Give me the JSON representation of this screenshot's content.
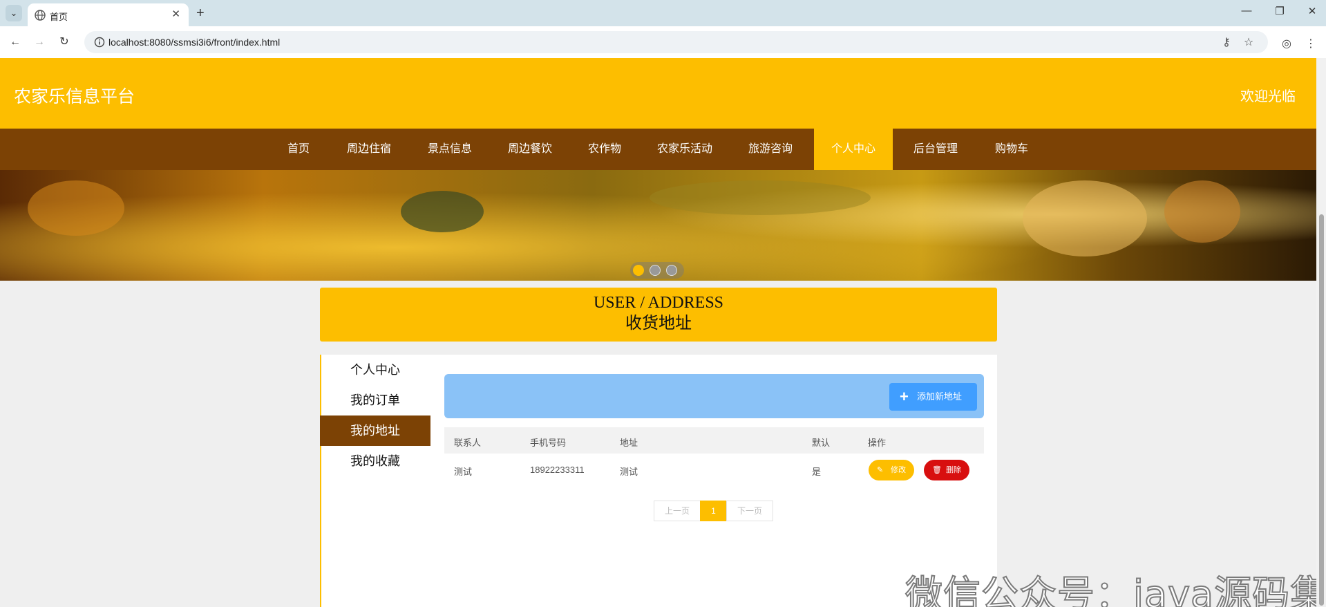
{
  "browser": {
    "tab_title": "首页",
    "url": "localhost:8080/ssmsi3i6/front/index.html"
  },
  "site": {
    "title": "农家乐信息平台",
    "welcome": "欢迎光临"
  },
  "nav": {
    "items": [
      "首页",
      "周边住宿",
      "景点信息",
      "周边餐饮",
      "农作物",
      "农家乐活动",
      "旅游咨询",
      "个人中心",
      "后台管理",
      "购物车"
    ],
    "active": "个人中心"
  },
  "banner": {
    "slide_count": 3,
    "active_slide": 1
  },
  "section": {
    "title_en": "USER / ADDRESS",
    "title_zh": "收货地址"
  },
  "sidebar": {
    "items": [
      "个人中心",
      "我的订单",
      "我的地址",
      "我的收藏"
    ],
    "active": "我的地址"
  },
  "panel": {
    "add_label": "添加新地址"
  },
  "table": {
    "columns": [
      "联系人",
      "手机号码",
      "地址",
      "默认",
      "操作"
    ],
    "rows": [
      {
        "contact": "测试",
        "phone": "18922233311",
        "address": "测试",
        "default": "是"
      }
    ],
    "edit_label": "修改",
    "delete_label": "删除"
  },
  "pagination": {
    "prev": "上一页",
    "current": "1",
    "next": "下一页"
  },
  "watermark": "微信公众号：java源码集合",
  "colors": {
    "brand_yellow": "#fdbe00",
    "brand_brown": "#7c4205",
    "blue": "#409eff",
    "red": "#d80f0f"
  },
  "icons": [
    "globe-icon",
    "close-icon",
    "plus-icon",
    "back-icon",
    "forward-icon",
    "reload-icon",
    "info-icon",
    "key-icon",
    "star-icon",
    "profile-icon",
    "more-icon",
    "pencil-icon",
    "trash-icon"
  ]
}
